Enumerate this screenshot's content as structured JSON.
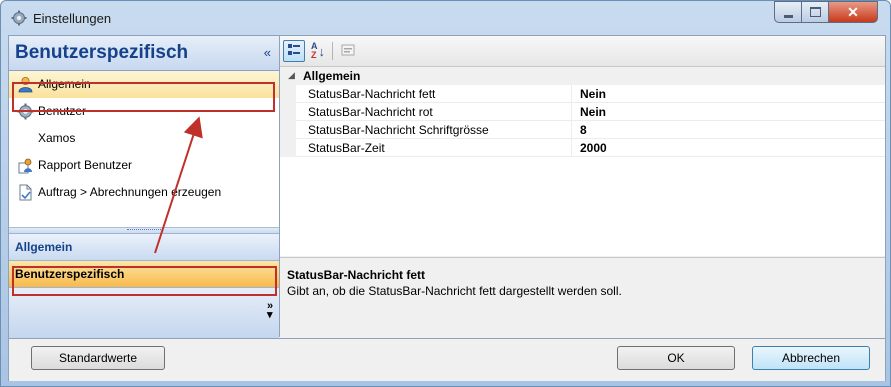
{
  "window": {
    "title": "Einstellungen",
    "controls": {
      "minimize": "minimize",
      "maximize": "maximize",
      "close": "x"
    }
  },
  "nav": {
    "header_title": "Benutzerspezifisch",
    "collapse_glyph": "«",
    "items": [
      {
        "label": "Allgemein",
        "icon": "user-icon",
        "selected": true
      },
      {
        "label": "Benutzer",
        "icon": "gear-icon",
        "selected": false
      },
      {
        "label": "Xamos",
        "icon": "",
        "selected": false
      },
      {
        "label": "Rapport Benutzer",
        "icon": "report-icon",
        "selected": false
      },
      {
        "label": "Auftrag > Abrechnungen erzeugen",
        "icon": "document-icon",
        "selected": false
      }
    ],
    "groups": [
      {
        "label": "Allgemein",
        "active": false
      },
      {
        "label": "Benutzerspezifisch",
        "active": true
      }
    ],
    "overflow_glyph": "»"
  },
  "toolbar": {
    "az_label": "A Z"
  },
  "propertygrid": {
    "category": "Allgemein",
    "rows": [
      {
        "name": "StatusBar-Nachricht fett",
        "value": "Nein"
      },
      {
        "name": "StatusBar-Nachricht rot",
        "value": "Nein"
      },
      {
        "name": "StatusBar-Nachricht Schriftgrösse",
        "value": "8"
      },
      {
        "name": "StatusBar-Zeit",
        "value": "2000"
      }
    ]
  },
  "help": {
    "title": "StatusBar-Nachricht fett",
    "description": "Gibt an, ob die StatusBar-Nachricht fett dargestellt werden soll."
  },
  "buttons": {
    "defaults": "Standardwerte",
    "ok": "OK",
    "cancel": "Abbrechen"
  },
  "colors": {
    "accent": "#15428b",
    "selection": "#f8b94a",
    "annotation": "#c0302a"
  }
}
